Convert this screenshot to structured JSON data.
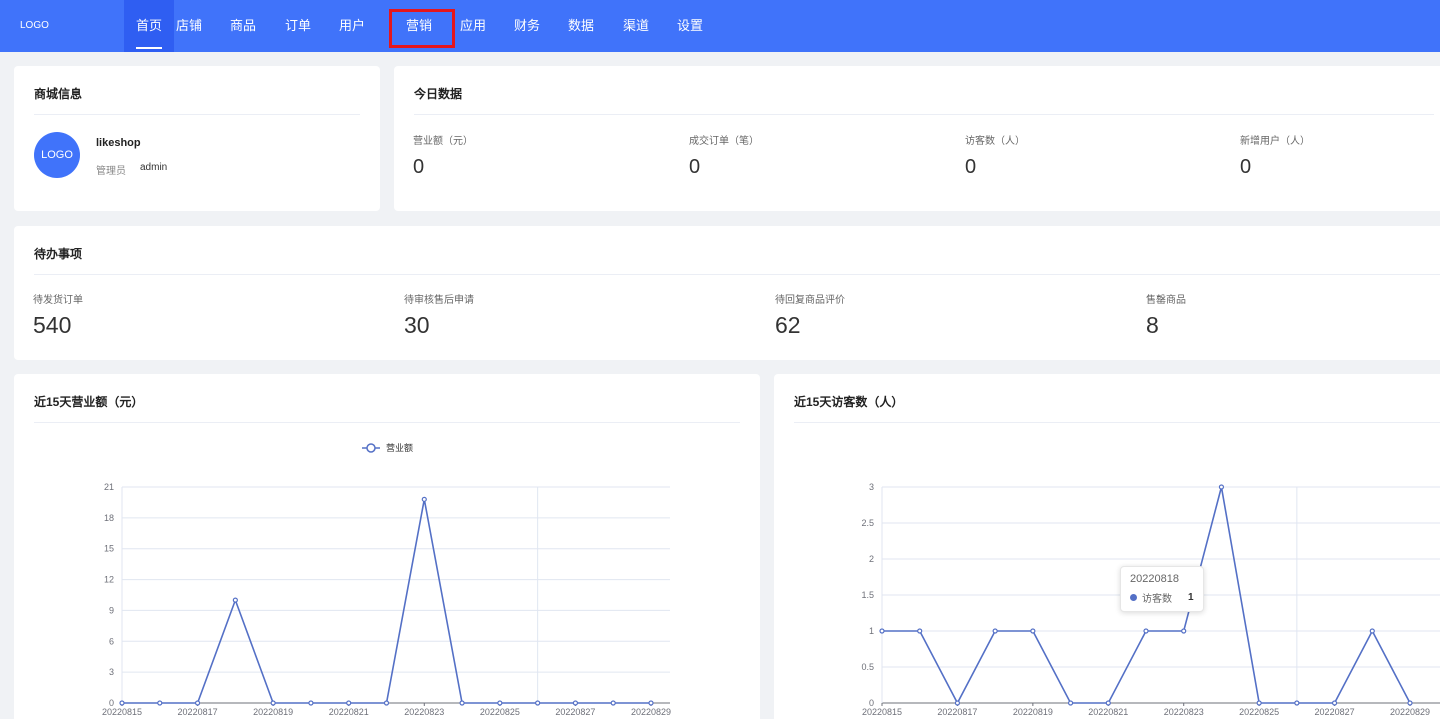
{
  "header": {
    "logo": "LOGO",
    "nav": [
      {
        "label": "首页",
        "active": true
      },
      {
        "label": "店铺"
      },
      {
        "label": "商品"
      },
      {
        "label": "订单"
      },
      {
        "label": "用户"
      },
      {
        "label": "营销",
        "highlighted": true
      },
      {
        "label": "应用"
      },
      {
        "label": "财务"
      },
      {
        "label": "数据"
      },
      {
        "label": "渠道"
      },
      {
        "label": "设置"
      }
    ]
  },
  "shop_info": {
    "title": "商城信息",
    "avatar_text": "LOGO",
    "shop_name": "likeshop",
    "role_label": "管理员",
    "role_value": "admin"
  },
  "today": {
    "title": "今日数据",
    "stats": [
      {
        "label": "营业额（元）",
        "value": "0"
      },
      {
        "label": "成交订单（笔）",
        "value": "0"
      },
      {
        "label": "访客数（人）",
        "value": "0"
      },
      {
        "label": "新增用户（人）",
        "value": "0"
      }
    ]
  },
  "todo": {
    "title": "待办事项",
    "items": [
      {
        "label": "待发货订单",
        "value": "540"
      },
      {
        "label": "待审核售后申请",
        "value": "30"
      },
      {
        "label": "待回复商品评价",
        "value": "62"
      },
      {
        "label": "售罄商品",
        "value": "8"
      }
    ]
  },
  "colors": {
    "primary": "#4073fa",
    "series": "#5470c6",
    "highlight": "#e5161c"
  },
  "chart_data": [
    {
      "type": "line",
      "title": "近15天营业额（元）",
      "legend": "营业额",
      "legend_position": "top-center",
      "x": [
        "20220815",
        "20220816",
        "20220817",
        "20220818",
        "20220819",
        "20220820",
        "20220821",
        "20220822",
        "20220823",
        "20220824",
        "20220825",
        "20220826",
        "20220827",
        "20220828",
        "20220829"
      ],
      "x_tick_labels": [
        "20220815",
        "20220817",
        "20220819",
        "20220821",
        "20220823",
        "20220825",
        "20220827",
        "20220829"
      ],
      "series": [
        {
          "name": "营业额",
          "values": [
            0,
            0,
            0,
            10,
            0,
            0,
            0,
            0,
            19.8,
            0,
            0,
            0,
            0,
            0,
            0
          ]
        }
      ],
      "yticks": [
        "0",
        "3",
        "6",
        "9",
        "12",
        "15",
        "18",
        "21"
      ],
      "ylim": [
        0,
        21
      ],
      "grid": true
    },
    {
      "type": "line",
      "title": "近15天访客数（人）",
      "x": [
        "20220815",
        "20220816",
        "20220817",
        "20220818",
        "20220819",
        "20220820",
        "20220821",
        "20220822",
        "20220823",
        "20220824",
        "20220825",
        "20220826",
        "20220827",
        "20220828",
        "20220829"
      ],
      "x_tick_labels": [
        "20220815",
        "20220817",
        "20220819",
        "20220821",
        "20220823",
        "20220825",
        "20220827",
        "20220829"
      ],
      "series": [
        {
          "name": "访客数",
          "values": [
            1,
            1,
            0,
            1,
            1,
            0,
            0,
            1,
            1,
            3,
            0,
            0,
            0,
            1,
            0
          ]
        }
      ],
      "yticks": [
        "0",
        "0.5",
        "1",
        "1.5",
        "2",
        "2.5",
        "3"
      ],
      "ylim": [
        0,
        3
      ],
      "grid": true,
      "tooltip": {
        "date": "20220818",
        "label": "访客数",
        "value": "1"
      }
    }
  ]
}
